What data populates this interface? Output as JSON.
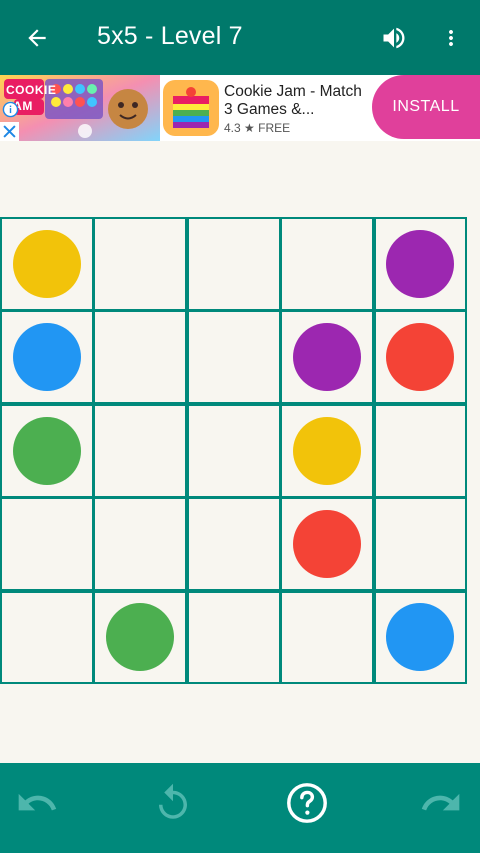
{
  "app_bar": {
    "title": "5x5 - Level 7",
    "back_icon": "arrow-left-icon",
    "sound_icon": "volume-icon",
    "more_icon": "more-vert-icon",
    "background": "#00796b"
  },
  "ad": {
    "image_text": "COOKIE JAM",
    "title": "Cookie Jam - Match 3 Games &...",
    "rating": "4.3",
    "star": "★",
    "price": "FREE",
    "install_label": "INSTALL",
    "install_color": "#e0409b"
  },
  "board": {
    "size": 5,
    "grid_color": "#00897b",
    "dots": [
      {
        "row": 0,
        "col": 0,
        "color": "#f2c30a"
      },
      {
        "row": 0,
        "col": 4,
        "color": "#9c27b0"
      },
      {
        "row": 1,
        "col": 0,
        "color": "#2196f3"
      },
      {
        "row": 1,
        "col": 3,
        "color": "#9c27b0"
      },
      {
        "row": 1,
        "col": 4,
        "color": "#f44336"
      },
      {
        "row": 2,
        "col": 0,
        "color": "#4caf50"
      },
      {
        "row": 2,
        "col": 3,
        "color": "#f2c30a"
      },
      {
        "row": 3,
        "col": 3,
        "color": "#f44336"
      },
      {
        "row": 4,
        "col": 1,
        "color": "#4caf50"
      },
      {
        "row": 4,
        "col": 4,
        "color": "#2196f3"
      }
    ]
  },
  "bottom_bar": {
    "undo_icon": "undo-icon",
    "restart_icon": "restart-icon",
    "help_icon": "help-circle-icon",
    "redo_icon": "redo-icon",
    "background": "#00897b"
  }
}
